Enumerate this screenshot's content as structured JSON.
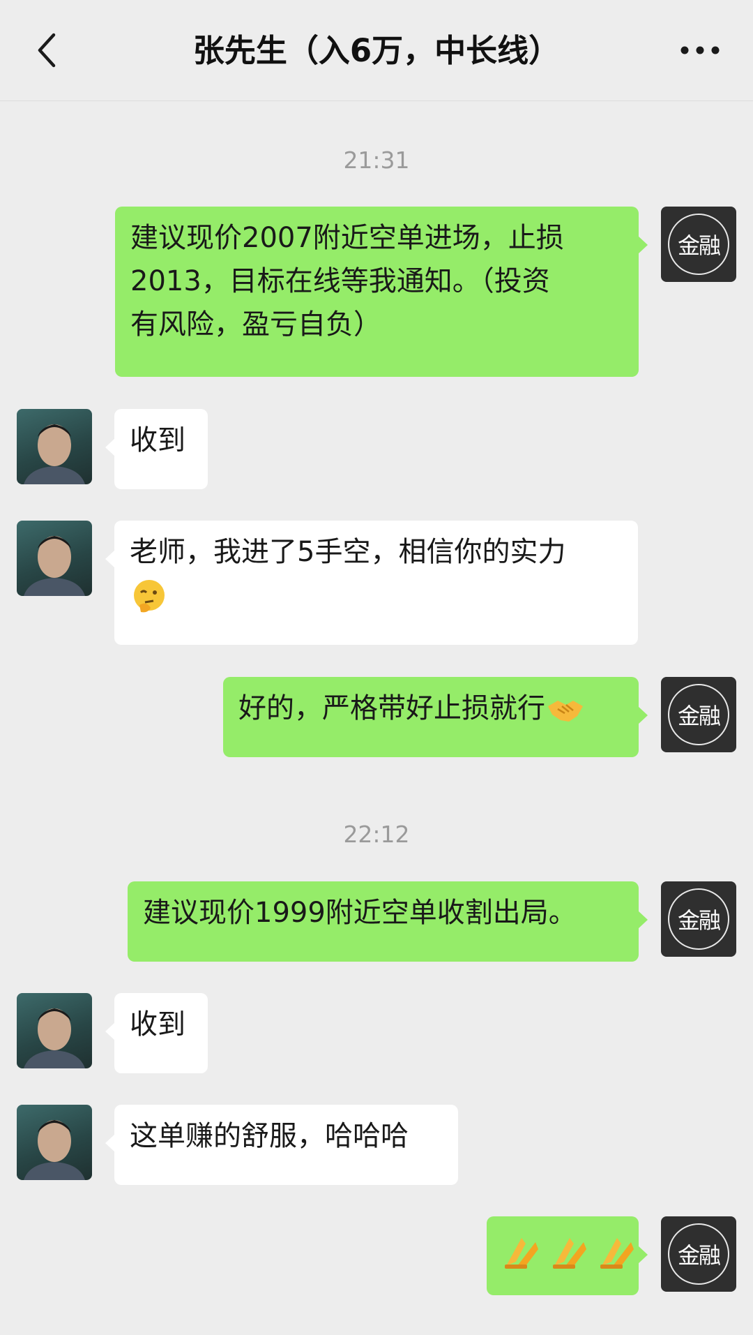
{
  "header": {
    "title": "张先生（入6万，中长线）"
  },
  "icons": {
    "back": "chevron-left-icon",
    "more": "more-dots-icon",
    "emoji_think": "thinking-face-icon",
    "emoji_handshake": "handshake-icon",
    "emoji_pray": "folded-hands-icon"
  },
  "colors": {
    "background": "#ededed",
    "outgoing_bubble": "#95ec69",
    "incoming_bubble": "#ffffff",
    "timestamp": "#9a9a9a"
  },
  "contact_avatar": {
    "text": "金融"
  },
  "timestamps": {
    "t1": "21:31",
    "t2": "22:12"
  },
  "messages": {
    "m1": {
      "line1": "建议现价2007附近空单进场，止损",
      "line2": "2013，目标在线等我通知。（投资",
      "line3": "有风险，盈亏自负）"
    },
    "m2": "收到",
    "m3": {
      "line1": "老师，我进了5手空，相信你的实力"
    },
    "m4": "好的，严格带好止损就行",
    "m5": "建议现价1999附近空单收割出局。",
    "m6": "收到",
    "m7": "这单赚的舒服，哈哈哈"
  }
}
